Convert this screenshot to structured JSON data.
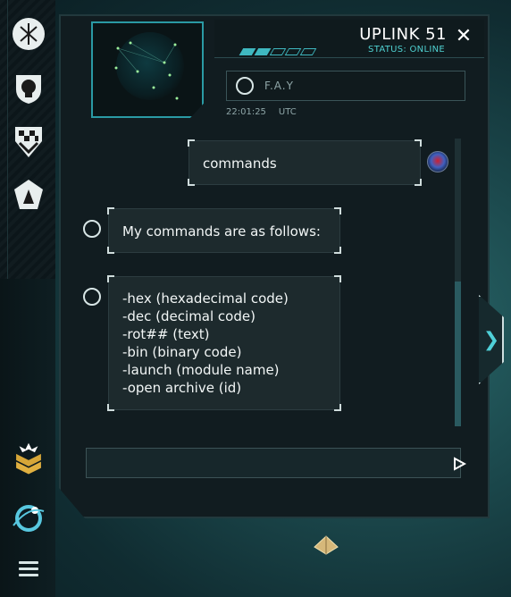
{
  "header": {
    "title": "UPLINK 51",
    "status": "STATUS: ONLINE",
    "close_glyph": "✕"
  },
  "contact": {
    "name": "F.A.Y",
    "time": "22:01:25",
    "timezone": "UTC"
  },
  "messages": [
    {
      "from": "user",
      "text": "commands"
    },
    {
      "from": "bot",
      "text": "My commands are as follows:"
    },
    {
      "from": "bot",
      "lines": [
        "-hex (hexadecimal code)",
        "-dec (decimal code)",
        "-rot## (text)",
        "-bin (binary code)",
        "-launch (module name)",
        "-open archive (id)"
      ]
    }
  ],
  "sidebar": {
    "icons": [
      "arrows-emblem-icon",
      "skull-shield-icon",
      "checker-crest-icon",
      "wolf-crest-icon",
      "rank-chevron-icon",
      "planet-orbit-icon",
      "menu-icon"
    ]
  },
  "colors": {
    "accent": "#3fb8c0",
    "background": "#1c4a4e",
    "panel": "#111c20"
  }
}
